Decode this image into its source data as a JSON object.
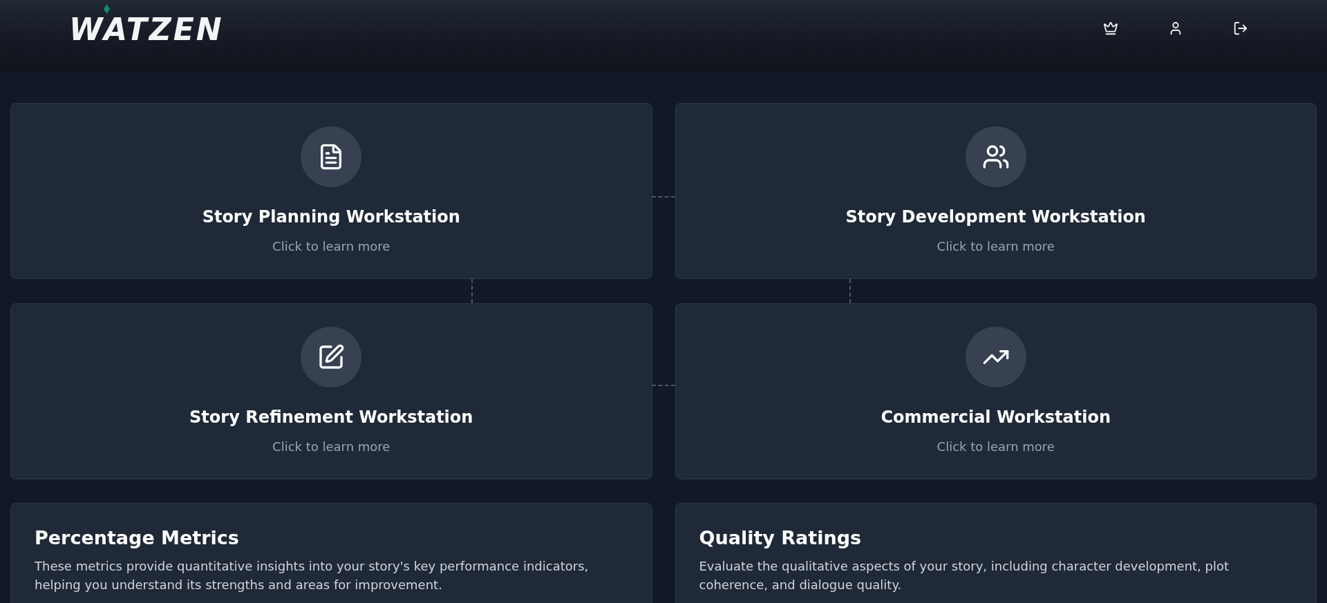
{
  "header": {
    "logo": "WATZEN",
    "actions": [
      {
        "kind": "premium"
      },
      {
        "kind": "profile"
      },
      {
        "kind": "logout"
      }
    ]
  },
  "workstations": [
    {
      "kind": "planning",
      "title": "Story Planning Workstation",
      "subtitle": "Click to learn more"
    },
    {
      "kind": "development",
      "title": "Story Development Workstation",
      "subtitle": "Click to learn more"
    },
    {
      "kind": "refinement",
      "title": "Story Refinement Workstation",
      "subtitle": "Click to learn more"
    },
    {
      "kind": "commercial",
      "title": "Commercial Workstation",
      "subtitle": "Click to learn more"
    }
  ],
  "info_cards": [
    {
      "title": "Percentage Metrics",
      "description": "These metrics provide quantitative insights into your story's key performance indicators, helping you understand its strengths and areas for improvement."
    },
    {
      "title": "Quality Ratings",
      "description": "Evaluate the qualitative aspects of your story, including character development, plot coherence, and dialogue quality."
    }
  ]
}
